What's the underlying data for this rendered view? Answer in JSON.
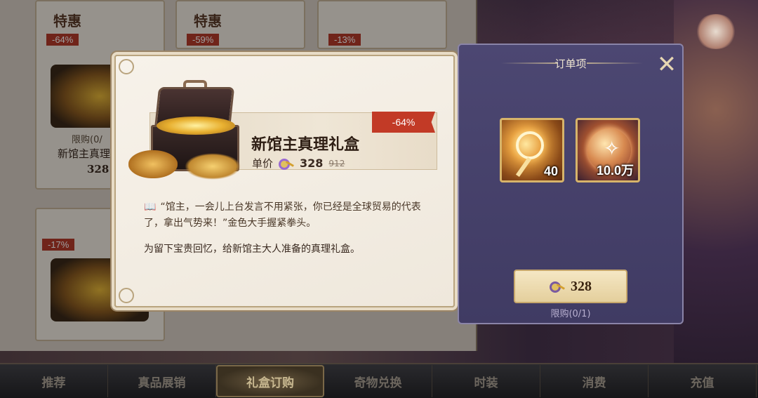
{
  "shop_cards": [
    {
      "tag": "特惠",
      "discount": "-64%"
    },
    {
      "tag": "特惠",
      "discount": "-59%"
    },
    {
      "tag": "",
      "discount": "-13%"
    },
    {
      "tag": "",
      "discount": "-17%"
    }
  ],
  "background_card": {
    "limit": "限购(0/",
    "name": "新馆主真理",
    "price": "328"
  },
  "product": {
    "discount": "-64%",
    "title": "新馆主真理礼盒",
    "price_label": "单价",
    "price": "328",
    "original_price": "912",
    "quote": "“馆主，一会儿上台发言不用紧张，你已经是全球贸易的代表了，拿出气势来！”金色大手握紧拳头。",
    "description": "为留下宝贵回忆，给新馆主大人准备的真理礼盒。"
  },
  "order": {
    "title": "订单项",
    "items": [
      {
        "icon": "truth-key-icon",
        "count": "40"
      },
      {
        "icon": "gold-orb-icon",
        "count": "10.0万"
      }
    ],
    "buy_price": "328",
    "limit": "限购(0/1)"
  },
  "nav": {
    "tabs": [
      "推荐",
      "真品展销",
      "礼盒订购",
      "奇物兑换",
      "时装",
      "消费",
      "充值"
    ],
    "active": "礼盒订购"
  },
  "colors": {
    "discount_red": "#c23a26",
    "panel_purple": "#4c4772",
    "gold_border": "#d7b46a"
  }
}
